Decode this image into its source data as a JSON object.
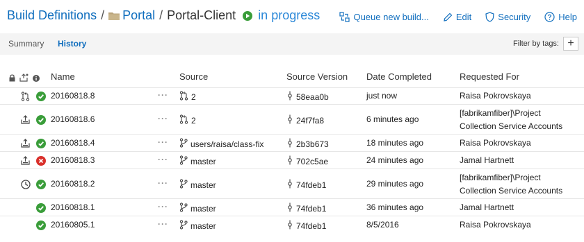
{
  "breadcrumb": {
    "root": "Build Definitions",
    "separator": "/",
    "folder": "Portal",
    "definition": "Portal-Client",
    "status": "in progress"
  },
  "actions": {
    "queue": "Queue new build...",
    "edit": "Edit",
    "security": "Security",
    "help": "Help"
  },
  "tabs": {
    "summary": "Summary",
    "history": "History"
  },
  "filter": {
    "label": "Filter by tags:",
    "add": "+"
  },
  "columns": {
    "name": "Name",
    "source": "Source",
    "version": "Source Version",
    "date": "Date Completed",
    "requested": "Requested For"
  },
  "colors": {
    "link": "#106ebe",
    "success": "#3a9d3a",
    "failure": "#d9302b"
  },
  "rows": [
    {
      "reason": "pull-request-icon",
      "result": "success",
      "name": "20160818.8",
      "source": "2",
      "source_icon": "pull-request-icon",
      "version": "58eaa0b",
      "date": "just now",
      "requested": "Raisa Pokrovskaya"
    },
    {
      "reason": "triggered-icon",
      "result": "success",
      "name": "20160818.6",
      "source": "2",
      "source_icon": "pull-request-icon",
      "version": "24f7fa8",
      "date": "6 minutes ago",
      "requested": "[fabrikamfiber]\\Project Collection Service Accounts"
    },
    {
      "reason": "triggered-icon",
      "result": "success",
      "name": "20160818.4",
      "source": "users/raisa/class-fix",
      "source_icon": "branch-icon",
      "version": "2b3b673",
      "date": "18 minutes ago",
      "requested": "Raisa Pokrovskaya"
    },
    {
      "reason": "triggered-icon",
      "result": "failure",
      "name": "20160818.3",
      "source": "master",
      "source_icon": "branch-icon",
      "version": "702c5ae",
      "date": "24 minutes ago",
      "requested": "Jamal Hartnett"
    },
    {
      "reason": "scheduled-icon",
      "result": "success",
      "name": "20160818.2",
      "source": "master",
      "source_icon": "branch-icon",
      "version": "74fdeb1",
      "date": "29 minutes ago",
      "requested": "[fabrikamfiber]\\Project Collection Service Accounts"
    },
    {
      "reason": "",
      "result": "success",
      "name": "20160818.1",
      "source": "master",
      "source_icon": "branch-icon",
      "version": "74fdeb1",
      "date": "36 minutes ago",
      "requested": "Jamal Hartnett"
    },
    {
      "reason": "",
      "result": "success",
      "name": "20160805.1",
      "source": "master",
      "source_icon": "branch-icon",
      "version": "74fdeb1",
      "date": "8/5/2016",
      "requested": "Raisa Pokrovskaya"
    }
  ]
}
